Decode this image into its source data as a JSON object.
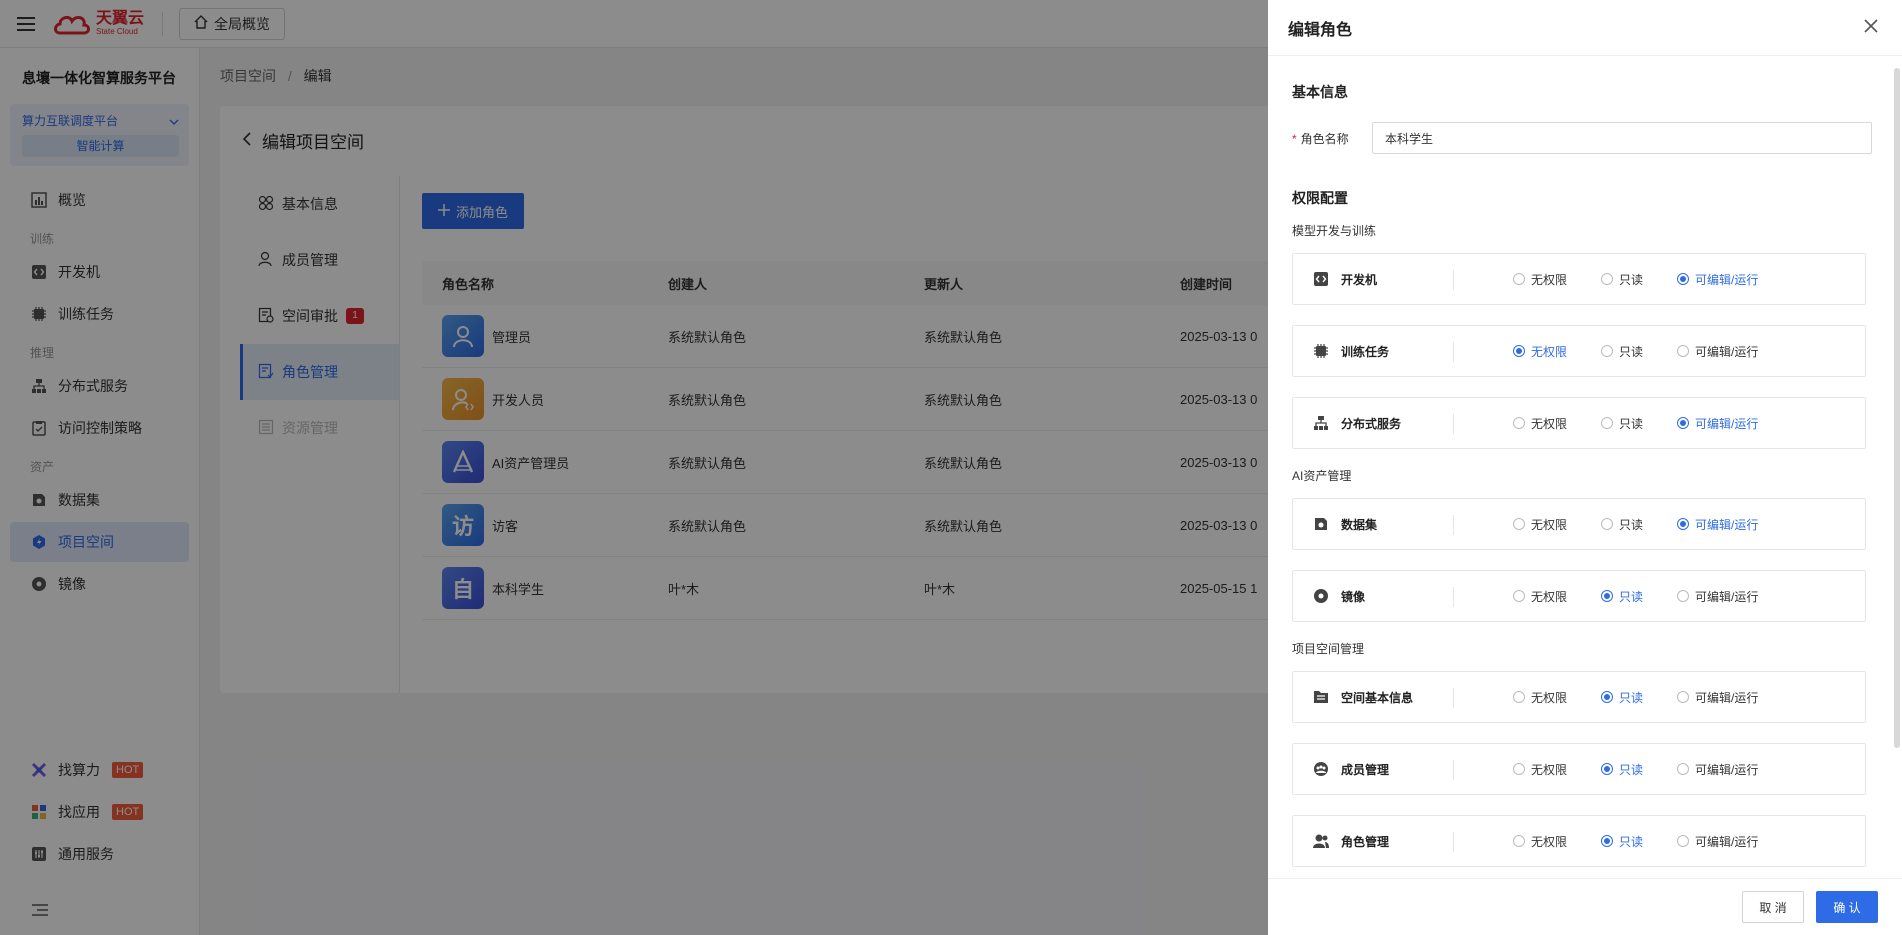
{
  "topbar": {
    "logo_cn": "天翼云",
    "logo_en": "State Cloud",
    "overview_label": "全局概览"
  },
  "sidebar": {
    "platform_title": "息壤一体化智算服务平台",
    "platform_select": "算力互联调度平台",
    "platform_sub": "智能计算",
    "groups": {
      "train": "训练",
      "infer": "推理",
      "asset": "资产"
    },
    "items": {
      "overview": "概览",
      "devbox": "开发机",
      "train_task": "训练任务",
      "dist_service": "分布式服务",
      "access_policy": "访问控制策略",
      "dataset": "数据集",
      "project_space": "项目空间",
      "image": "镜像",
      "find_compute": "找算力",
      "find_app": "找应用",
      "general_service": "通用服务"
    },
    "hot_label": "HOT"
  },
  "breadcrumb": {
    "root": "项目空间",
    "sep": "/",
    "current": "编辑"
  },
  "main": {
    "title": "编辑项目空间",
    "subnav": {
      "basic": "基本信息",
      "members": "成员管理",
      "approval": "空间审批",
      "approval_badge": "1",
      "roles": "角色管理",
      "resources": "资源管理"
    },
    "add_role": "添加角色",
    "table": {
      "headers": [
        "角色名称",
        "创建人",
        "更新人",
        "创建时间"
      ],
      "rows": [
        {
          "name": "管理员",
          "creator": "系统默认角色",
          "updater": "系统默认角色",
          "time": "2025-03-13 0"
        },
        {
          "name": "开发人员",
          "creator": "系统默认角色",
          "updater": "系统默认角色",
          "time": "2025-03-13 0"
        },
        {
          "name": "AI资产管理员",
          "creator": "系统默认角色",
          "updater": "系统默认角色",
          "time": "2025-03-13 0"
        },
        {
          "name": "访客",
          "creator": "系统默认角色",
          "updater": "系统默认角色",
          "time": "2025-03-13 0"
        },
        {
          "name": "本科学生",
          "creator": "叶*木",
          "updater": "叶*木",
          "time": "2025-05-15 1"
        }
      ],
      "avatar_chars": {
        "guest": "访",
        "student": "自"
      }
    }
  },
  "drawer": {
    "title": "编辑角色",
    "basic_section": "基本信息",
    "role_name_label": "角色名称",
    "role_name_value": "本科学生",
    "perm_section": "权限配置",
    "options": [
      "无权限",
      "只读",
      "可编辑/运行"
    ],
    "groups": [
      {
        "title": "模型开发与训练",
        "items": [
          {
            "name": "开发机",
            "selected": 2
          },
          {
            "name": "训练任务",
            "selected": 0
          },
          {
            "name": "分布式服务",
            "selected": 2
          }
        ]
      },
      {
        "title": "AI资产管理",
        "items": [
          {
            "name": "数据集",
            "selected": 2
          },
          {
            "name": "镜像",
            "selected": 1
          }
        ]
      },
      {
        "title": "项目空间管理",
        "items": [
          {
            "name": "空间基本信息",
            "selected": 1
          },
          {
            "name": "成员管理",
            "selected": 1
          },
          {
            "name": "角色管理",
            "selected": 1
          }
        ]
      }
    ],
    "cancel_label": "取 消",
    "ok_label": "确 认"
  }
}
